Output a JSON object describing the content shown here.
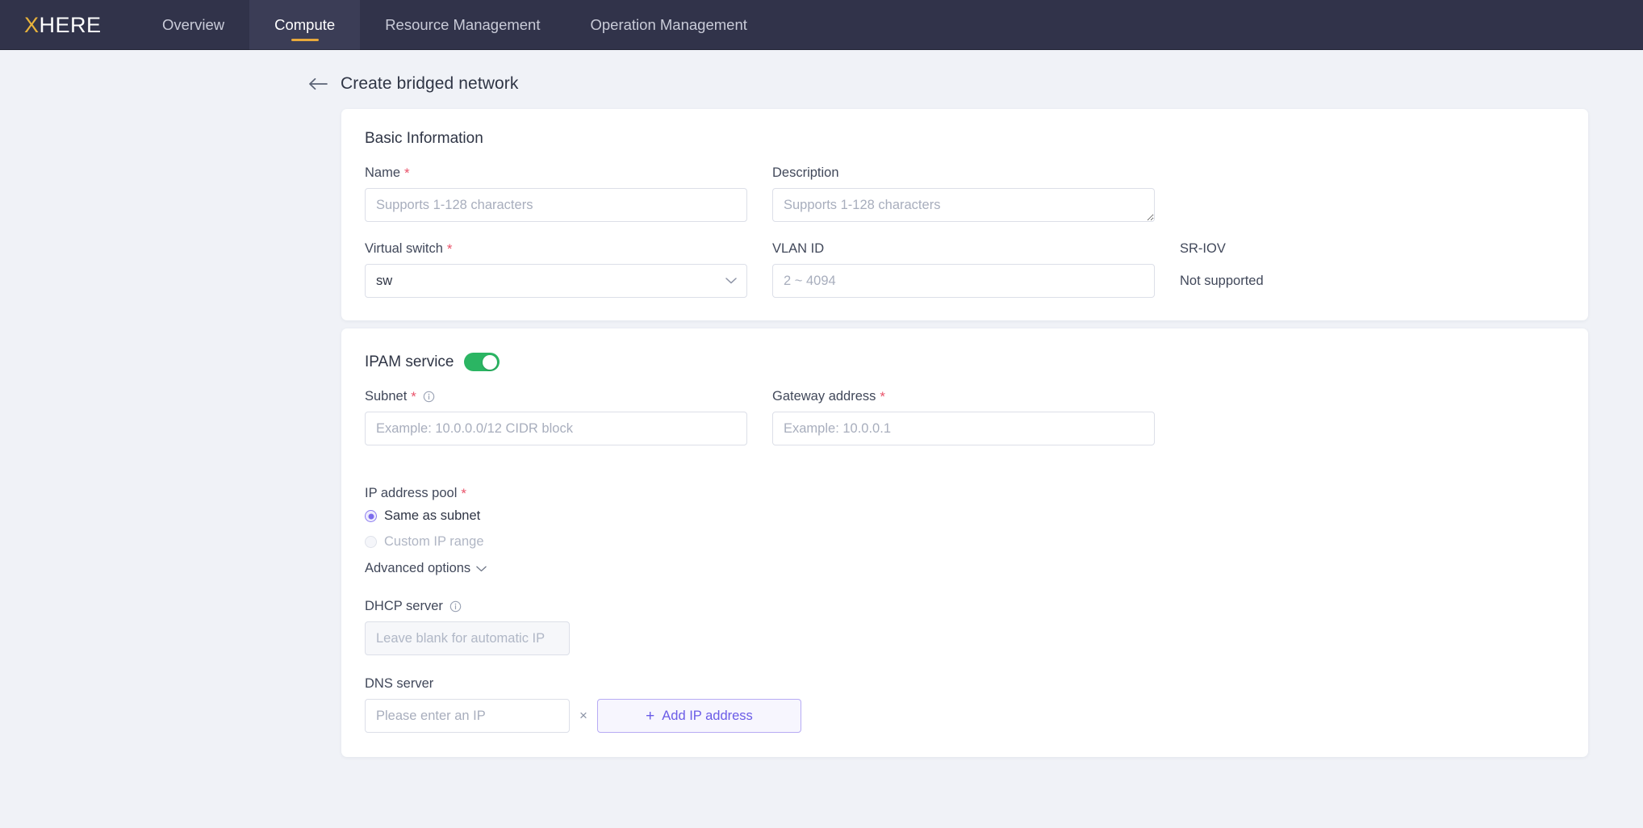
{
  "app": {
    "brand_x": "X",
    "brand_rest": "HERE",
    "accent_gold": "#e8a93c",
    "accent_purple": "#6b5ce7",
    "toggle_green": "#2bb563",
    "required_red": "#e9536a"
  },
  "nav": {
    "items": [
      {
        "label": "Overview",
        "active": false
      },
      {
        "label": "Compute",
        "active": true
      },
      {
        "label": "Resource Management",
        "active": false
      },
      {
        "label": "Operation Management",
        "active": false
      }
    ]
  },
  "header": {
    "back_icon": "arrow-left-icon",
    "title": "Create bridged network"
  },
  "basic": {
    "title": "Basic Information",
    "name": {
      "label": "Name",
      "required": "*",
      "value": "",
      "placeholder": "Supports 1-128 characters"
    },
    "description": {
      "label": "Description",
      "value": "",
      "placeholder": "Supports 1-128 characters"
    },
    "virtual_switch": {
      "label": "Virtual switch",
      "required": "*",
      "value": "sw",
      "chevron": "chevron-down-icon"
    },
    "vlan_id": {
      "label": "VLAN ID",
      "value": "",
      "placeholder": "2 ~ 4094"
    },
    "sriov": {
      "label": "SR-IOV",
      "value": "Not supported"
    }
  },
  "ipam": {
    "title": "IPAM service",
    "enabled": true,
    "subnet": {
      "label": "Subnet",
      "required": "*",
      "info_icon": "info-circle-icon",
      "value": "",
      "placeholder": "Example: 10.0.0.0/12 CIDR block"
    },
    "gateway": {
      "label": "Gateway address",
      "required": "*",
      "value": "",
      "placeholder": "Example: 10.0.0.1"
    },
    "ip_pool": {
      "label": "IP address pool",
      "required": "*",
      "options": [
        {
          "label": "Same as subnet",
          "selected": true,
          "disabled": false
        },
        {
          "label": "Custom IP range",
          "selected": false,
          "disabled": true
        }
      ]
    },
    "advanced": {
      "label": "Advanced options",
      "chevron": "chevron-down-icon"
    },
    "dhcp": {
      "label": "DHCP server",
      "info_icon": "info-circle-icon",
      "value": "",
      "placeholder": "Leave blank for automatic IP",
      "disabled": true
    },
    "dns": {
      "label": "DNS server",
      "value": "",
      "placeholder": "Please enter an IP",
      "remove_label": "×",
      "add_label": "Add IP address",
      "add_plus": "+"
    }
  }
}
